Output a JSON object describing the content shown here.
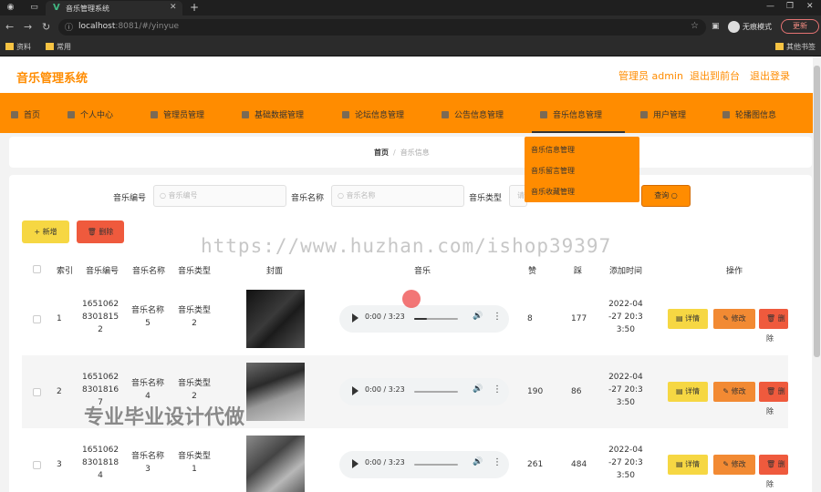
{
  "browser": {
    "tab_title": "音乐管理系统",
    "url_host": "localhost",
    "url_rest": ":8081/#/yinyue",
    "profile_label": "无痕模式",
    "update_label": "更新",
    "bookmarks": [
      "资料",
      "常用"
    ],
    "other_bookmarks": "其他书签"
  },
  "header": {
    "brand": "音乐管理系统",
    "admin": "管理员 admin",
    "back_link": "退出到前台",
    "logout": "退出登录"
  },
  "menu": [
    {
      "label": "首页"
    },
    {
      "label": "个人中心"
    },
    {
      "label": "管理员管理"
    },
    {
      "label": "基础数据管理"
    },
    {
      "label": "论坛信息管理"
    },
    {
      "label": "公告信息管理"
    },
    {
      "label": "音乐信息管理"
    },
    {
      "label": "用户管理"
    },
    {
      "label": "轮播图信息"
    }
  ],
  "dropdown": [
    "音乐信息管理",
    "音乐留言管理",
    "音乐收藏管理"
  ],
  "breadcrumb": {
    "home": "首页",
    "sep": "/",
    "current": "音乐信息"
  },
  "search": {
    "fields": [
      {
        "label": "音乐编号",
        "placeholder": "音乐编号"
      },
      {
        "label": "音乐名称",
        "placeholder": "音乐名称"
      },
      {
        "label": "音乐类型",
        "placeholder": "请"
      }
    ],
    "query_label": "查询"
  },
  "toolbar": {
    "add_label": "+ 新增",
    "delete_label": "删除"
  },
  "table": {
    "headers": [
      "索引",
      "音乐编号",
      "音乐名称",
      "音乐类型",
      "封面",
      "音乐",
      "赞",
      "踩",
      "添加时间",
      "操作"
    ],
    "rows": [
      {
        "index": "1",
        "code": [
          "1651062",
          "8301815",
          "2"
        ],
        "name": [
          "音乐名称",
          "5"
        ],
        "type": [
          "音乐类型",
          "2"
        ],
        "time_text": "0:00 / 3:23",
        "progress": 0.3,
        "likes": "8",
        "dislikes": "177",
        "date": [
          "2022-04",
          "-27 20:3",
          "3:50"
        ]
      },
      {
        "index": "2",
        "code": [
          "1651062",
          "8301816",
          "7"
        ],
        "name": [
          "音乐名称",
          "4"
        ],
        "type": [
          "音乐类型",
          "2"
        ],
        "time_text": "0:00 / 3:23",
        "progress": 0,
        "likes": "190",
        "dislikes": "86",
        "date": [
          "2022-04",
          "-27 20:3",
          "3:50"
        ]
      },
      {
        "index": "3",
        "code": [
          "1651062",
          "8301818",
          "4"
        ],
        "name": [
          "音乐名称",
          "3"
        ],
        "type": [
          "音乐类型",
          "1"
        ],
        "time_text": "0:00 / 3:23",
        "progress": 0,
        "likes": "261",
        "dislikes": "484",
        "date": [
          "2022-04",
          "-27 20:3",
          "3:50"
        ]
      }
    ],
    "actions": {
      "detail": "详情",
      "edit": "修改",
      "delete": "删除"
    }
  },
  "watermarks": {
    "url": "https://www.huzhan.com/ishop39397",
    "slogan": "专业毕业设计代做"
  },
  "colors": {
    "accent": "#ff8c00",
    "yellow": "#f6d743",
    "orange": "#f28a33",
    "red": "#ef5a3d"
  }
}
